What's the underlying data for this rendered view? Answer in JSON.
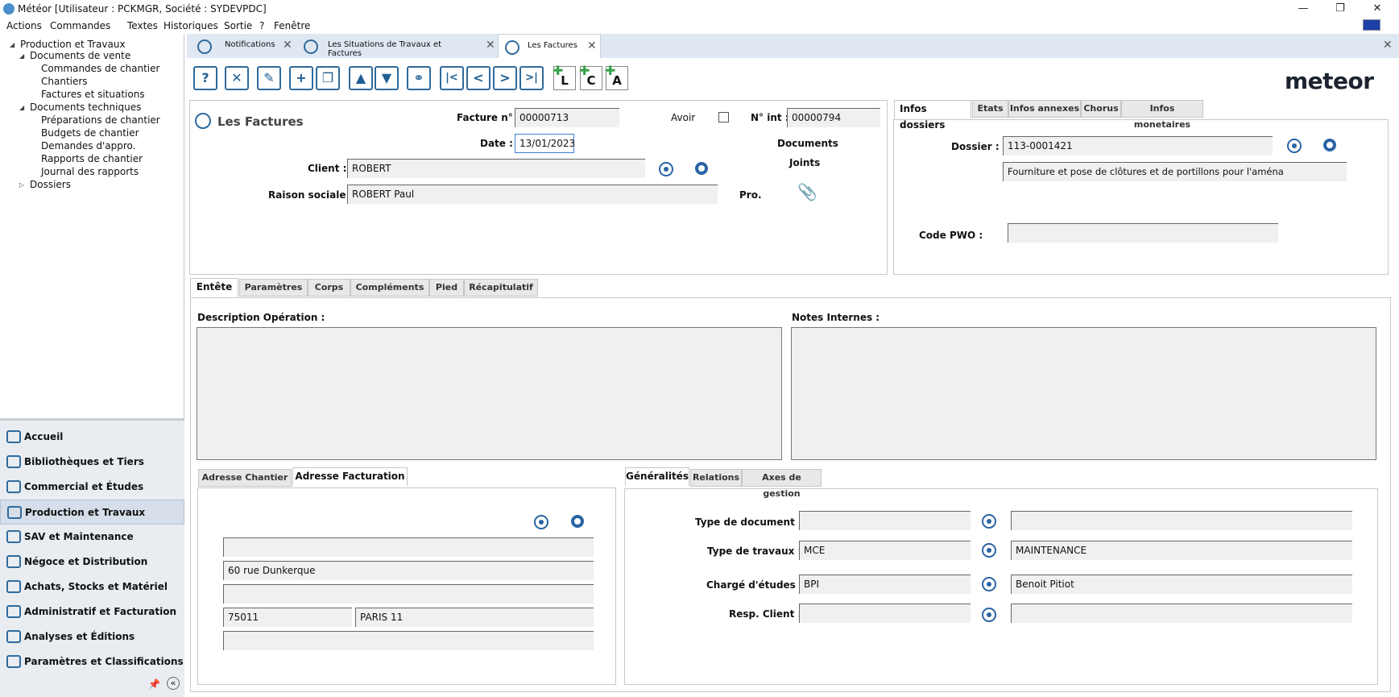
{
  "window": {
    "title": "Météor [Utilisateur : PCKMGR, Société : SYDEVPDC]",
    "controls": {
      "minimize": "—",
      "maximize": "❐",
      "close": "✕"
    }
  },
  "menu": [
    "Actions",
    "Commandes",
    "Textes",
    "Historiques",
    "Sortie",
    "?",
    "Fenêtre"
  ],
  "tree": {
    "root": "Production et Travaux",
    "docs_vente": "Documents de vente",
    "commandes": "Commandes de chantier",
    "chantiers": "Chantiers",
    "factures_sit": "Factures et situations",
    "docs_tech": "Documents techniques",
    "preparations": "Préparations de chantier",
    "budgets": "Budgets de chantier",
    "demandes": "Demandes d'appro.",
    "rapports": "Rapports de chantier",
    "journal": "Journal des rapports",
    "dossiers": "Dossiers"
  },
  "modules": [
    "Accueil",
    "Bibliothèques et Tiers",
    "Commercial et Études",
    "Production et Travaux",
    "SAV et Maintenance",
    "Négoce et Distribution",
    "Achats, Stocks et Matériel",
    "Administratif et Facturation",
    "Analyses et Éditions",
    "Paramètres et Classifications"
  ],
  "doc_tabs": [
    "Notifications",
    "Les Situations de Travaux et Factures",
    "Les Factures"
  ],
  "toolbar": {
    "help": "?",
    "delete": "✕",
    "edit": "✎",
    "add": "+",
    "copy": "❐",
    "up": "▲",
    "down": "▼",
    "find": "⚭",
    "first": "|<",
    "prev": "<",
    "next": ">",
    "last": ">|",
    "add_l": "L",
    "add_c": "C",
    "add_a": "A"
  },
  "logo": "meteor",
  "facture": {
    "panel_title": "Les Factures",
    "facture_no_label": "Facture n°",
    "facture_no": "00000713",
    "avoir_label": "Avoir",
    "nint_label": "N° int :",
    "nint": "00000794",
    "date_label": "Date :",
    "date": "13/01/2023",
    "client_label": "Client :",
    "client": "ROBERT",
    "raison_label": "Raison sociale :",
    "raison": "ROBERT Paul",
    "docs_joints_1": "Documents",
    "docs_joints_2": "Joints",
    "pro_label": "Pro."
  },
  "dossier_tabs": [
    "Infos dossiers",
    "Etats",
    "Infos annexes",
    "Chorus",
    "Infos monetaires"
  ],
  "dossier": {
    "dossier_label": "Dossier :",
    "dossier_value": "113-0001421",
    "description": "Fourniture et pose de clôtures et de portillons pour l'aména",
    "pwo_label": "Code PWO :",
    "pwo_value": ""
  },
  "main_tabs": [
    "Entête",
    "Paramètres",
    "Corps",
    "Compléments",
    "Pied",
    "Récapitulatif"
  ],
  "entete": {
    "desc_label": "Description Opération :",
    "notes_label": "Notes Internes :"
  },
  "address_tabs": [
    "Adresse Chantier",
    "Adresse Facturation"
  ],
  "address": {
    "line1": "",
    "line2": "60 rue Dunkerque",
    "line3": "",
    "postal": "75011",
    "city": "PARIS 11",
    "line5": ""
  },
  "gen_tabs": [
    "Généralités",
    "Relations",
    "Axes de gestion"
  ],
  "generalites": {
    "type_doc_label": "Type de document :",
    "type_doc_code": "",
    "type_doc_name": "",
    "type_trav_label": "Type de travaux :",
    "type_trav_code": "MCE",
    "type_trav_name": "MAINTENANCE",
    "charge_label": "Chargé d'études :",
    "charge_code": "BPI",
    "charge_name": "Benoit Pitiot",
    "resp_label": "Resp. Client :",
    "resp_code": "",
    "resp_name": ""
  },
  "icons": {
    "pin": "📌",
    "collapse": "«",
    "paperclip": "📎"
  }
}
